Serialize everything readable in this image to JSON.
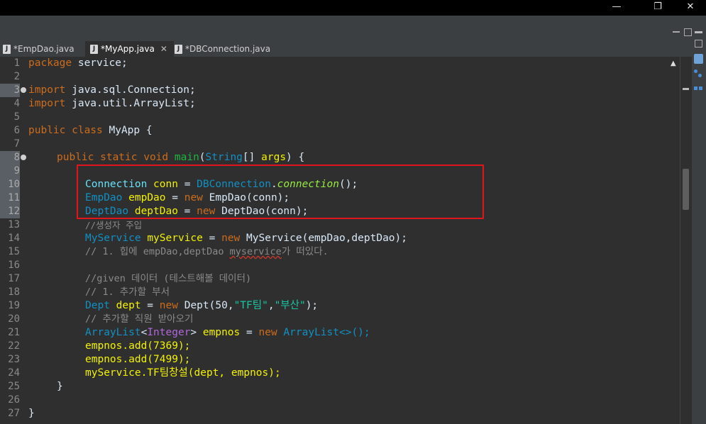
{
  "window": {
    "minimize_glyph": "—",
    "restore_glyph": "❐",
    "close_glyph": "✕"
  },
  "tabs": [
    {
      "label": "*EmpDao.java",
      "active": false
    },
    {
      "label": "*MyApp.java",
      "active": true
    },
    {
      "label": "*DBConnection.java",
      "active": false
    }
  ],
  "tab_close_glyph": "✕",
  "file_icon_glyph": "J",
  "line_numbers": [
    "1",
    "2",
    "3",
    "4",
    "5",
    "6",
    "7",
    "8",
    "9",
    "10",
    "11",
    "12",
    "13",
    "14",
    "15",
    "16",
    "17",
    "18",
    "19",
    "20",
    "21",
    "22",
    "23",
    "24",
    "25",
    "26",
    "27"
  ],
  "code": {
    "l1_kw": "package",
    "l1_rest": " service;",
    "l3_kw": "import",
    "l3_rest": " java.sql.Connection;",
    "l4_kw": "import",
    "l4_rest": " java.util.ArrayList;",
    "l6_kw": "public class",
    "l6_rest": " MyApp {",
    "l8_kw": "public static void",
    "l8_main": "main",
    "l8_paren": "(",
    "l8_string": "String",
    "l8_arr": "[] ",
    "l8_args": "args",
    "l8_end": ") {",
    "l10_type": "Connection",
    "l10_var": "conn",
    "l10_eq": " = ",
    "l10_cls": "DBConnection",
    "l10_dot": ".",
    "l10_method": "connection",
    "l10_end": "();",
    "l11_type": "EmpDao",
    "l11_var": "empDao",
    "l11_eq": " = ",
    "l11_new": "new",
    "l11_ctor": " EmpDao(conn);",
    "l12_type": "DeptDao",
    "l12_var": "deptDao",
    "l12_eq": " = ",
    "l12_new": "new",
    "l12_ctor": " DeptDao(conn);",
    "l13_cmt": "//생성자 주입",
    "l14_type": "MyService",
    "l14_var": "myService",
    "l14_eq": " = ",
    "l14_new": "new",
    "l14_ctor": " MyService(empDao,deptDao);",
    "l15_cmt_a": "// 1. 힙에 empDao,deptDao ",
    "l15_cmt_sq": "myservice",
    "l15_cmt_b": "가 떠있다.",
    "l17_cmt": "//given 데이터 (테스트해볼 데이터)",
    "l18_cmt": "// 1. 추가할 부서",
    "l19_type": "Dept",
    "l19_var": "dept",
    "l19_eq": " = ",
    "l19_new": "new",
    "l19_ctor": " Dept(50,",
    "l19_s1": "\"TF팀\"",
    "l19_comma": ",",
    "l19_s2": "\"부산\"",
    "l19_end": ");",
    "l20_cmt": "// 추가할 직원 받아오기",
    "l21_type": "ArrayList",
    "l21_lt": "<",
    "l21_int": "Integer",
    "l21_gt": "> ",
    "l21_var": "empnos",
    "l21_eq": " = ",
    "l21_new": "new",
    "l21_ctor": " ArrayList<>();",
    "l22": "empnos.add(7369);",
    "l23": "empnos.add(7499);",
    "l24": "myService.TF팀창설(dept, empnos);",
    "l25": "}",
    "l27": "}"
  },
  "colors": {
    "keyword": "#cc6c1d",
    "class": "#1290c3",
    "variable": "#f2f200",
    "comment": "#8a8a8a",
    "string": "#17c6a3",
    "highlight_box": "#e0161c"
  }
}
